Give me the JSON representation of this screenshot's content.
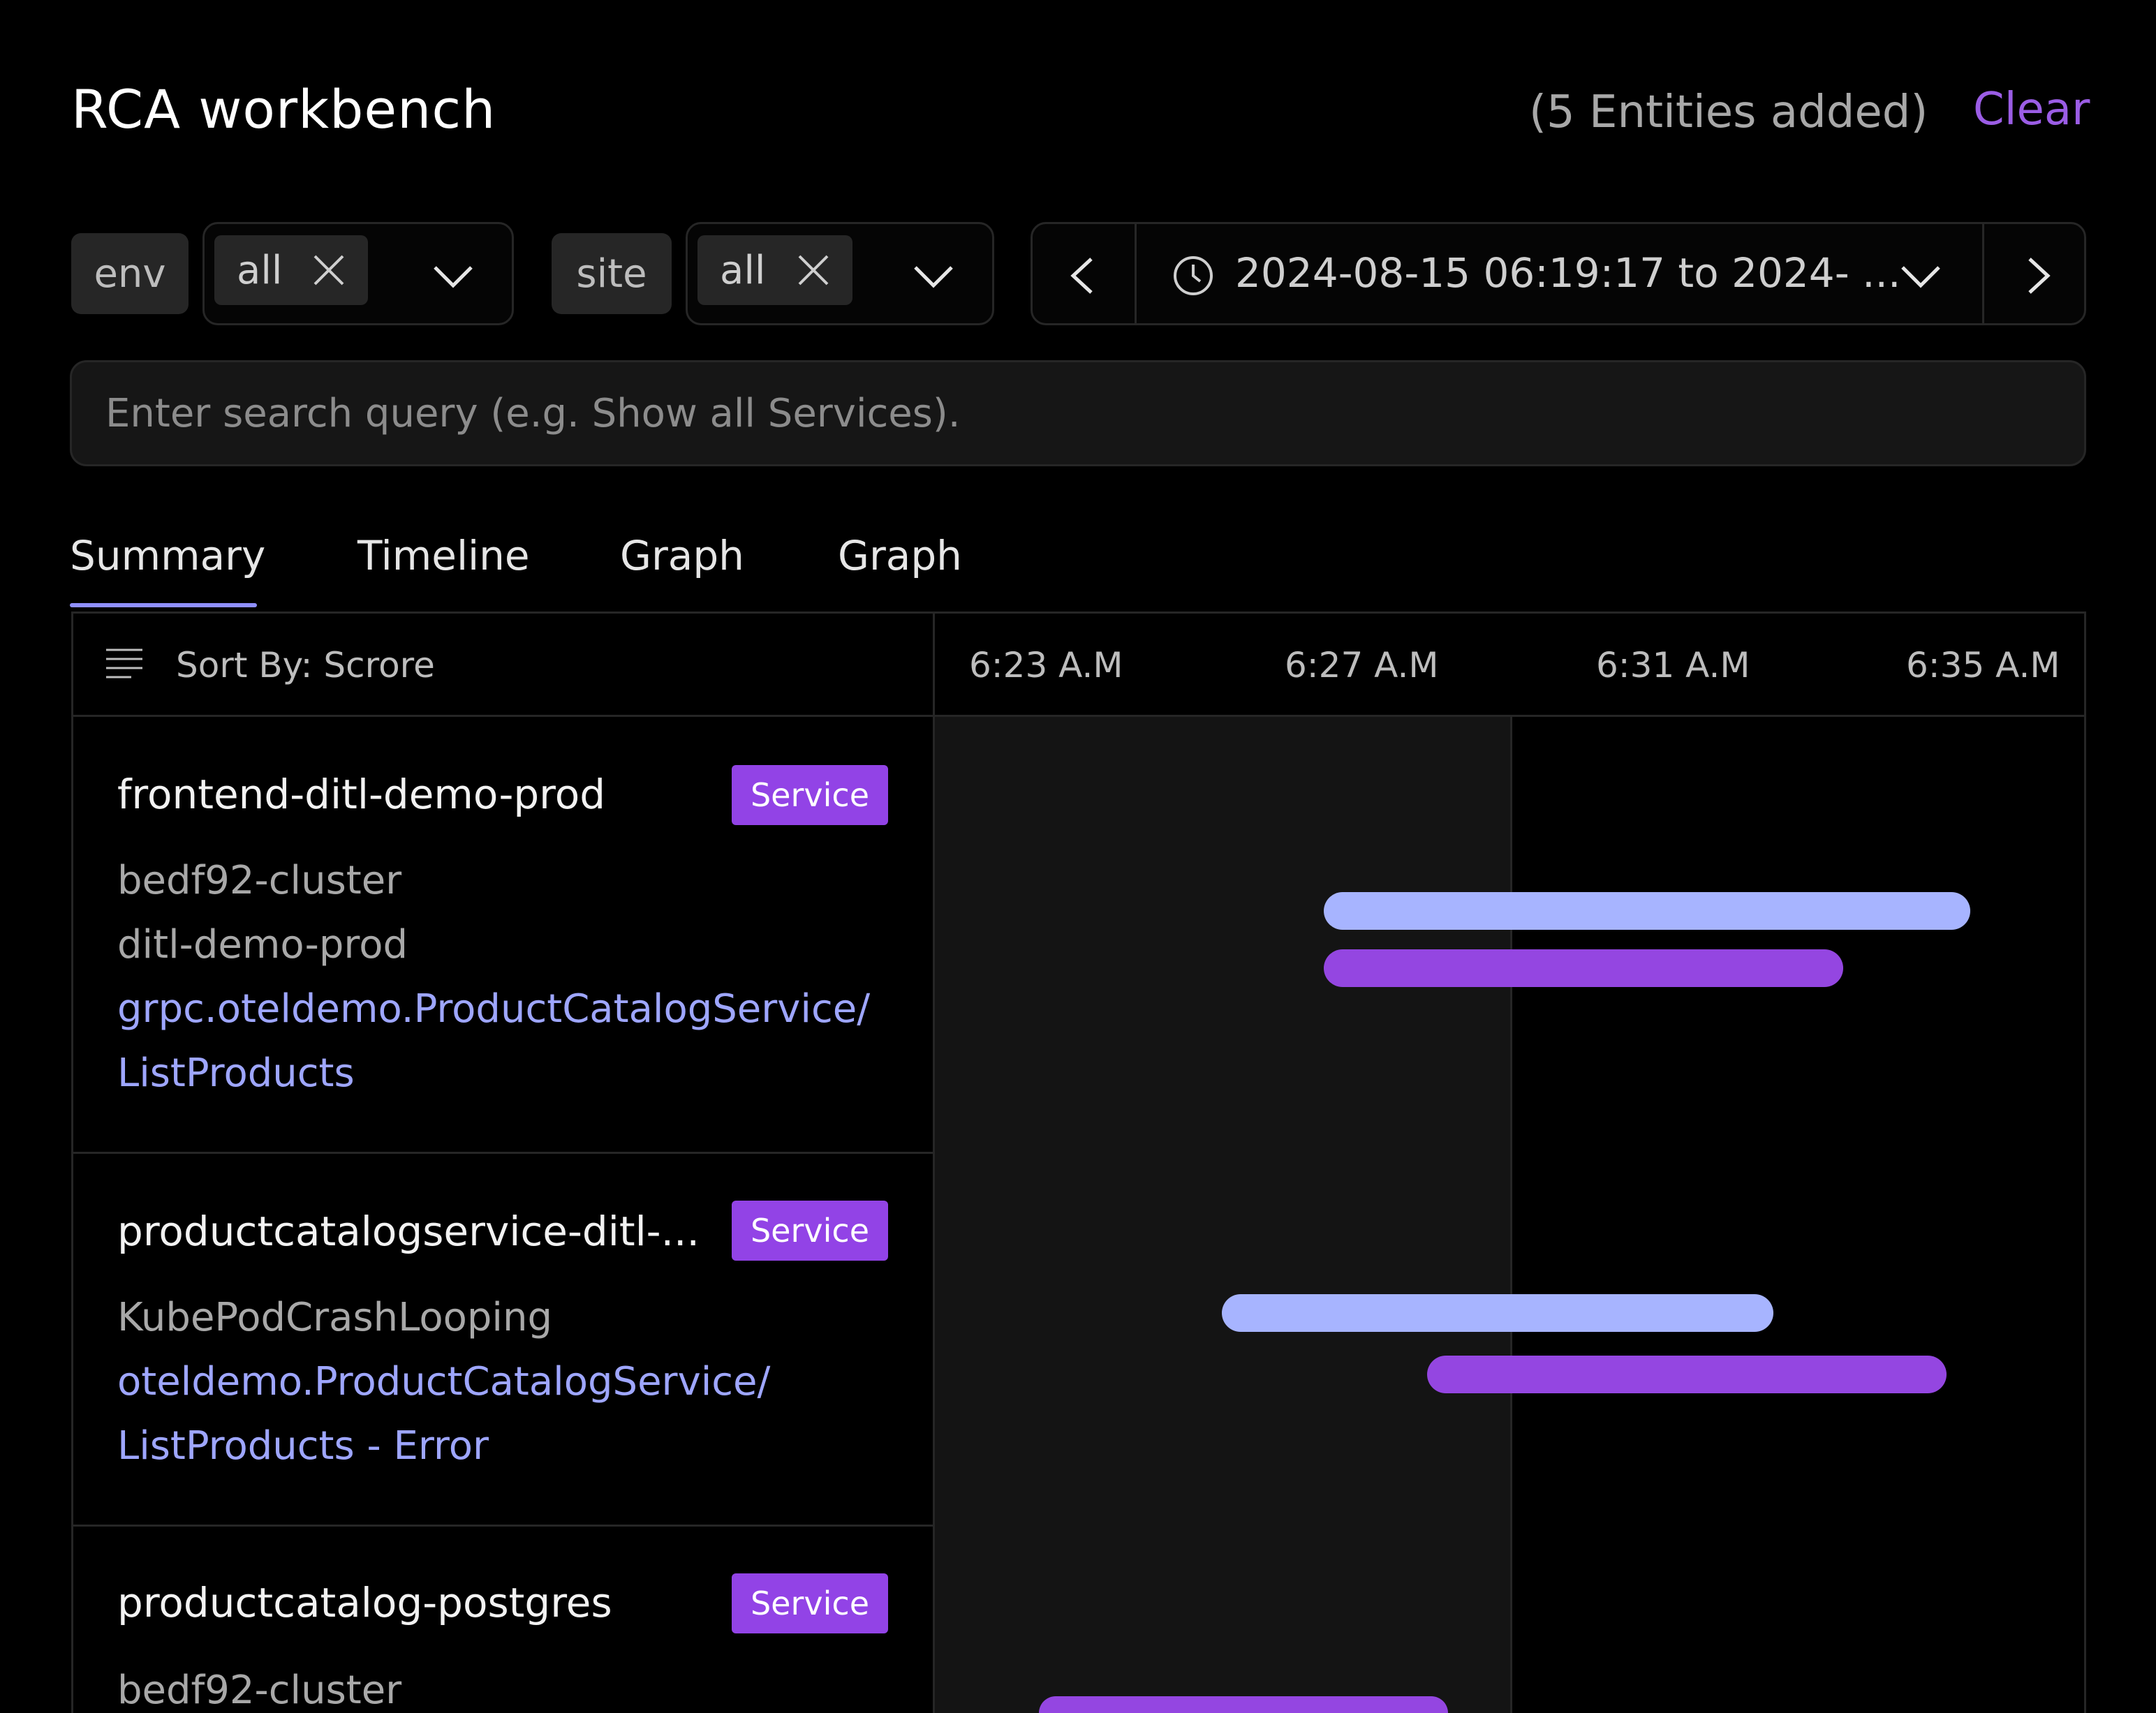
{
  "header": {
    "title": "RCA workbench",
    "entities_added": "(5 Entities added)",
    "clear_label": "Clear"
  },
  "filters": {
    "env": {
      "label": "env",
      "value": "all"
    },
    "site": {
      "label": "site",
      "value": "all"
    },
    "time_range": {
      "value": "2024-08-15 06:19:17 to 2024- ..."
    }
  },
  "search": {
    "placeholder": "Enter search query (e.g. Show all Services)."
  },
  "tabs": [
    {
      "label": "Summary",
      "active": true
    },
    {
      "label": "Timeline"
    },
    {
      "label": "Graph"
    },
    {
      "label": "Graph"
    }
  ],
  "table": {
    "sort_label": "Sort By: Scrore",
    "ticks": [
      "6:23 A.M",
      "6:27 A.M",
      "6:31 A.M",
      "6:35 A.M"
    ],
    "rows": [
      {
        "name": "frontend-ditl-demo-prod",
        "badge": "Service",
        "meta": [
          "bedf92-cluster",
          "ditl-demo-prod"
        ],
        "link": [
          "grpc.oteldemo.ProductCatalogService/",
          "ListProducts"
        ]
      },
      {
        "name": "productcatalogservice-ditl-...",
        "badge": "Service",
        "meta": [
          "KubePodCrashLooping"
        ],
        "link": [
          "oteldemo.ProductCatalogService/",
          "ListProducts - Error"
        ]
      },
      {
        "name": "productcatalog-postgres",
        "badge": "Service",
        "meta": [
          "bedf92-cluster"
        ],
        "link": []
      }
    ]
  },
  "colors": {
    "accent": "#9b5de5",
    "badge": "#9243e6",
    "bar_blue": "#a7b4ff",
    "bar_purple": "#9446e1",
    "link": "#9ea6ff"
  }
}
